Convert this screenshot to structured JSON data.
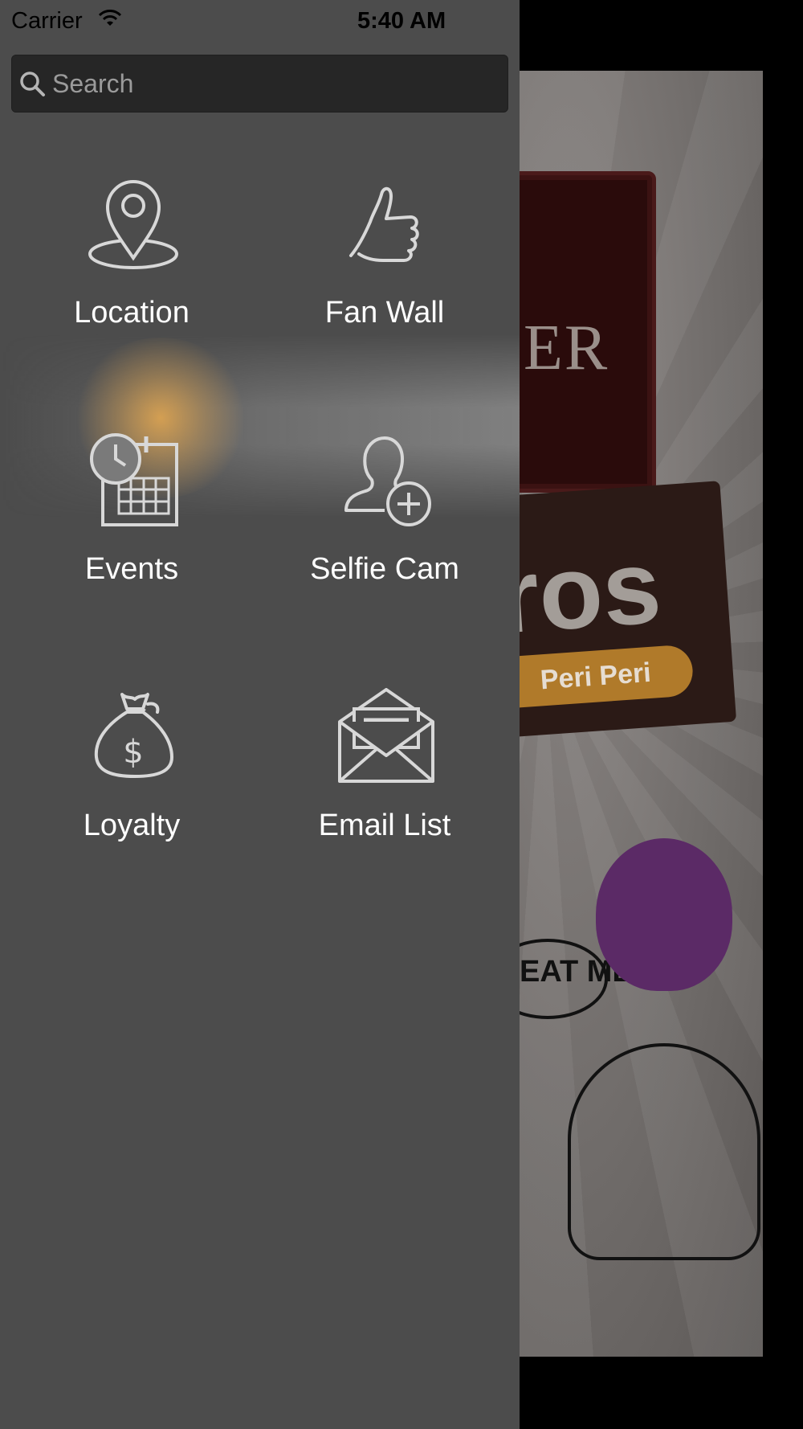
{
  "status_bar": {
    "carrier": "Carrier",
    "time": "5:40 AM"
  },
  "search": {
    "placeholder": "Search",
    "icon": "search-icon"
  },
  "menu": {
    "items": [
      {
        "label": "Location",
        "icon": "map-pin-icon"
      },
      {
        "label": "Fan Wall",
        "icon": "thumbs-up-icon"
      },
      {
        "label": "Events",
        "icon": "calendar-clock-icon"
      },
      {
        "label": "Selfie Cam",
        "icon": "add-person-icon"
      },
      {
        "label": "Loyalty",
        "icon": "money-bag-icon"
      },
      {
        "label": "Email List",
        "icon": "envelope-icon"
      }
    ]
  },
  "background": {
    "sign_text": "ER",
    "banner_text": "ros",
    "banner_pill": "Peri Peri",
    "speech_text": "EAT ME!!"
  },
  "colors": {
    "drawer": "#4c4c4c",
    "search_bg": "#262626",
    "icon_stroke": "#d8d8d8",
    "label": "#ffffff"
  }
}
